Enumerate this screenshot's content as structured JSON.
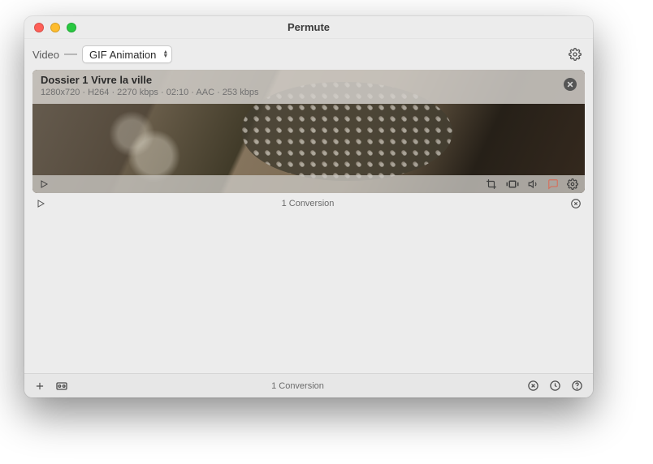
{
  "window": {
    "title": "Permute"
  },
  "toolbar": {
    "type_label": "Video",
    "dash": "—",
    "format_selected": "GIF Animation"
  },
  "item": {
    "title": "Dossier 1 Vivre la ville",
    "meta": "1280x720 · H264 · 2270 kbps · 02:10 · AAC · 253 kbps"
  },
  "status": {
    "row_text": "1 Conversion",
    "footer_text": "1 Conversion"
  }
}
